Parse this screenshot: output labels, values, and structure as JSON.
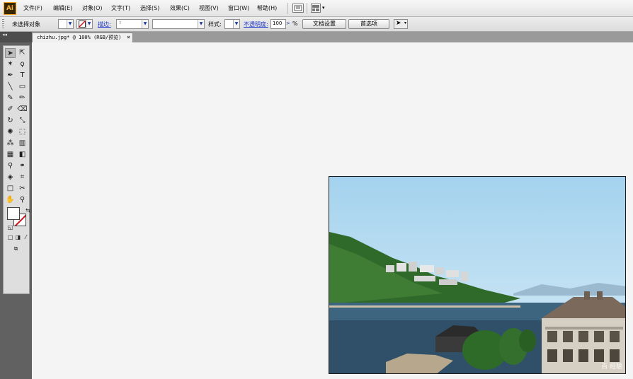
{
  "app": {
    "logo_text": "Ai"
  },
  "menu": {
    "items": [
      "文件(F)",
      "编辑(E)",
      "对象(O)",
      "文字(T)",
      "选择(S)",
      "效果(C)",
      "视图(V)",
      "窗口(W)",
      "帮助(H)"
    ]
  },
  "control": {
    "selection_label": "未选择对象",
    "stroke_label": "描边:",
    "style_label": "样式:",
    "opacity_label": "不透明度:",
    "opacity_value": "100",
    "opacity_unit": "%",
    "doc_setup_button": "文档设置",
    "prefs_button": "首选项"
  },
  "tabs": {
    "panel_collapse": "◂◂",
    "doc_tab_label": "chizhu.jpg* @ 100% (RGB/预览)",
    "close_glyph": "×"
  },
  "tools": [
    {
      "name": "selection-tool-icon",
      "glyph": "➤"
    },
    {
      "name": "direct-selection-tool-icon",
      "glyph": "⇱"
    },
    {
      "name": "magic-wand-tool-icon",
      "glyph": "✶"
    },
    {
      "name": "lasso-tool-icon",
      "glyph": "ϙ"
    },
    {
      "name": "pen-tool-icon",
      "glyph": "✒"
    },
    {
      "name": "type-tool-icon",
      "glyph": "T"
    },
    {
      "name": "line-tool-icon",
      "glyph": "╲"
    },
    {
      "name": "rectangle-tool-icon",
      "glyph": "▭"
    },
    {
      "name": "paintbrush-tool-icon",
      "glyph": "✎"
    },
    {
      "name": "pencil-tool-icon",
      "glyph": "✏"
    },
    {
      "name": "blob-brush-tool-icon",
      "glyph": "✐"
    },
    {
      "name": "eraser-tool-icon",
      "glyph": "⌫"
    },
    {
      "name": "rotate-tool-icon",
      "glyph": "↻"
    },
    {
      "name": "scale-tool-icon",
      "glyph": "⤡"
    },
    {
      "name": "warp-tool-icon",
      "glyph": "✺"
    },
    {
      "name": "free-transform-tool-icon",
      "glyph": "⬚"
    },
    {
      "name": "symbol-sprayer-tool-icon",
      "glyph": "⁂"
    },
    {
      "name": "column-graph-tool-icon",
      "glyph": "▥"
    },
    {
      "name": "mesh-tool-icon",
      "glyph": "▦"
    },
    {
      "name": "gradient-tool-icon",
      "glyph": "◧"
    },
    {
      "name": "eyedropper-tool-icon",
      "glyph": "⚲"
    },
    {
      "name": "blend-tool-icon",
      "glyph": "⚭"
    },
    {
      "name": "live-paint-bucket-tool-icon",
      "glyph": "◈"
    },
    {
      "name": "live-paint-selection-tool-icon",
      "glyph": "⌗"
    },
    {
      "name": "artboard-tool-icon",
      "glyph": "□"
    },
    {
      "name": "slice-tool-icon",
      "glyph": "✂"
    },
    {
      "name": "hand-tool-icon",
      "glyph": "✋"
    },
    {
      "name": "zoom-tool-icon",
      "glyph": "⚲"
    }
  ],
  "photo": {
    "watermark": "百 經驗"
  },
  "colors": {
    "accent_link": "#1a33c8",
    "stroke_none_red": "#d0101a",
    "ai_logo_bg": "#3a2600",
    "ai_logo_fg": "#f5b43c"
  }
}
